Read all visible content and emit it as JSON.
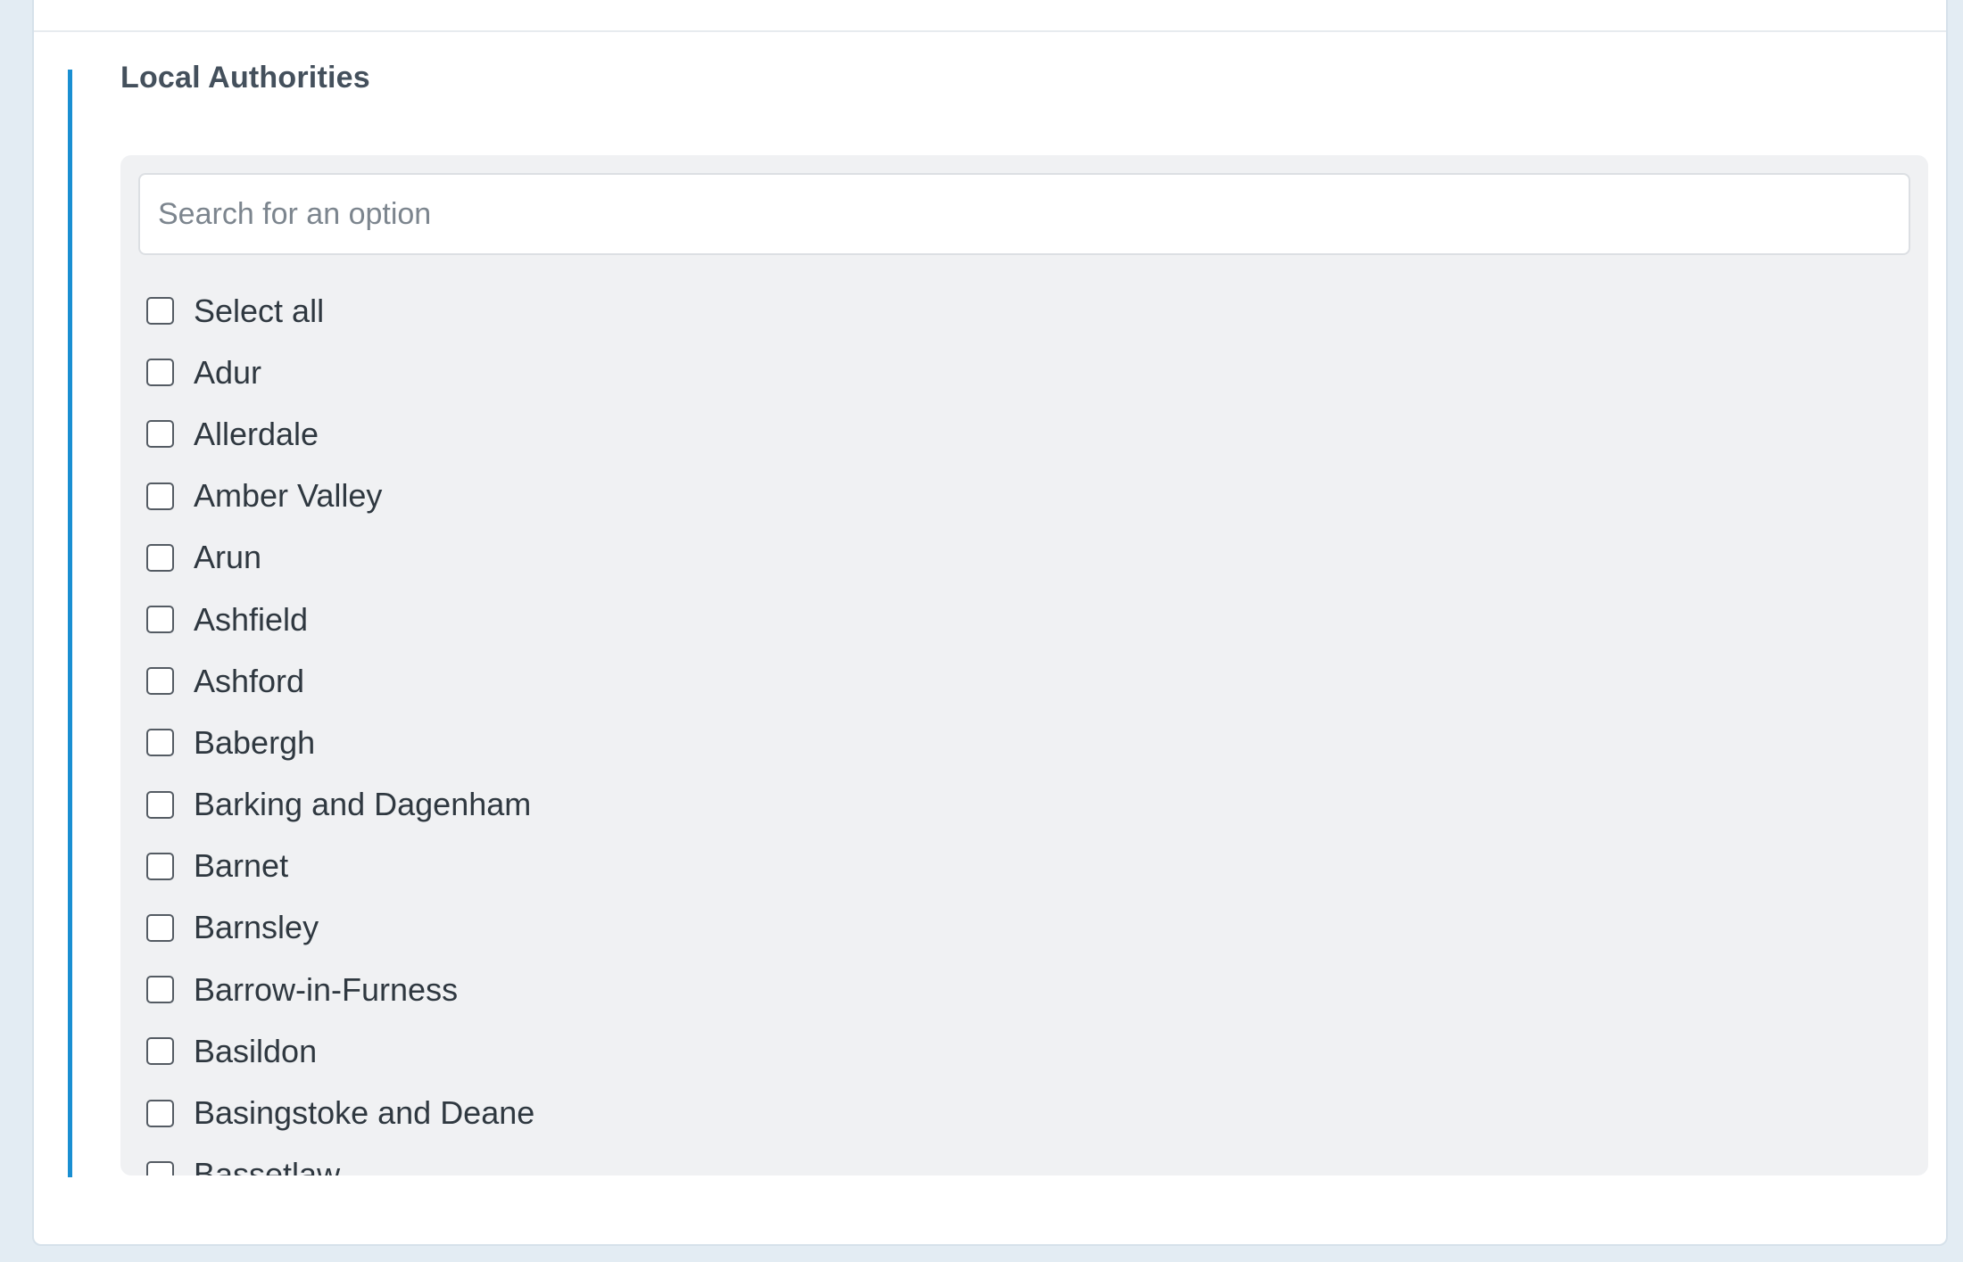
{
  "section": {
    "title": "Local Authorities"
  },
  "search": {
    "placeholder": "Search for an option",
    "value": ""
  },
  "options": [
    {
      "label": "Select all",
      "checked": false
    },
    {
      "label": "Adur",
      "checked": false
    },
    {
      "label": "Allerdale",
      "checked": false
    },
    {
      "label": "Amber Valley",
      "checked": false
    },
    {
      "label": "Arun",
      "checked": false
    },
    {
      "label": "Ashfield",
      "checked": false
    },
    {
      "label": "Ashford",
      "checked": false
    },
    {
      "label": "Babergh",
      "checked": false
    },
    {
      "label": "Barking and Dagenham",
      "checked": false
    },
    {
      "label": "Barnet",
      "checked": false
    },
    {
      "label": "Barnsley",
      "checked": false
    },
    {
      "label": "Barrow-in-Furness",
      "checked": false
    },
    {
      "label": "Basildon",
      "checked": false
    },
    {
      "label": "Basingstoke and Deane",
      "checked": false
    },
    {
      "label": "Bassetlaw",
      "checked": false
    }
  ],
  "colors": {
    "accent": "#1a8fd2",
    "panel_background": "#f0f1f3",
    "page_background": "#e3ecf3",
    "title_text": "#44505c"
  }
}
